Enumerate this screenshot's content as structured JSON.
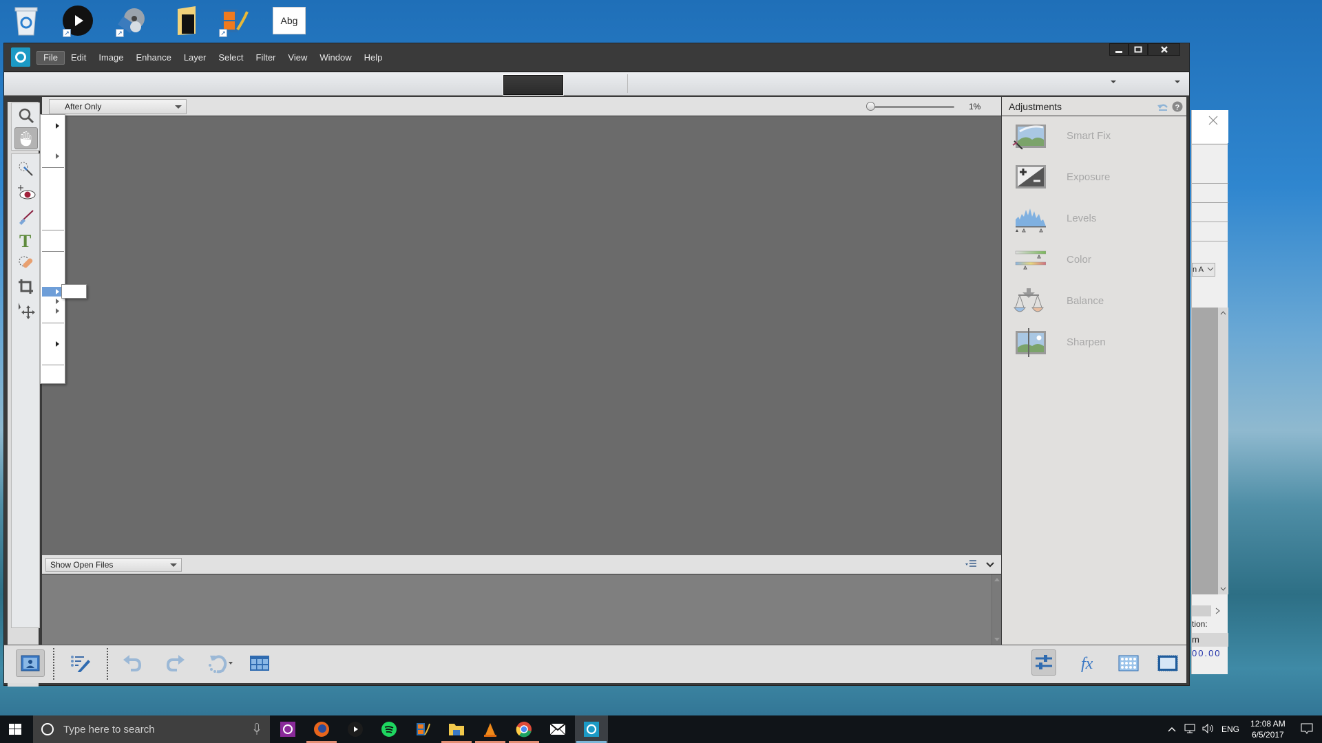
{
  "desktop": {
    "icons": [
      {
        "name": "recycle-bin-icon",
        "label": "Recycle Bin",
        "shortcut": false
      },
      {
        "name": "video-player-icon",
        "label": "",
        "shortcut": true
      },
      {
        "name": "media-player-icon",
        "label": "",
        "shortcut": true
      },
      {
        "name": "folder-icon",
        "label": "",
        "shortcut": false
      },
      {
        "name": "movie-maker-icon",
        "label": "",
        "shortcut": true
      },
      {
        "name": "font-file-icon",
        "label": "Abg",
        "shortcut": false
      }
    ]
  },
  "app": {
    "menu": [
      "File",
      "Edit",
      "Image",
      "Enhance",
      "Layer",
      "Select",
      "Filter",
      "View",
      "Window",
      "Help"
    ],
    "active_menu": "File",
    "window_controls": {
      "minimize": "▁",
      "maximize": "□",
      "close": "✕"
    },
    "options_bar": {
      "view_select": "After Only",
      "zoom_value": "1%",
      "zoom_fraction": 0.01
    },
    "photo_bin": {
      "select_value": "Show Open Files"
    },
    "adjustments": {
      "title": "Adjustments",
      "items": [
        {
          "label": "Smart Fix",
          "icon": "smart-fix-icon"
        },
        {
          "label": "Exposure",
          "icon": "exposure-icon"
        },
        {
          "label": "Levels",
          "icon": "levels-icon"
        },
        {
          "label": "Color",
          "icon": "color-icon"
        },
        {
          "label": "Balance",
          "icon": "balance-icon"
        },
        {
          "label": "Sharpen",
          "icon": "sharpen-icon"
        }
      ]
    },
    "toolbox": [
      "zoom-tool",
      "hand-tool",
      "quick-selection-tool",
      "red-eye-tool",
      "whiten-teeth-tool",
      "type-tool",
      "spot-healing-tool",
      "crop-tool",
      "move-tool"
    ],
    "bottom_bar": {
      "left": [
        "photo-bin",
        "tool-options",
        "undo",
        "redo",
        "rotate",
        "organizer"
      ],
      "right": [
        "adjustments",
        "effects",
        "textures",
        "frames"
      ]
    }
  },
  "background_window": {
    "dropdown_fragment": "n A",
    "label_fragment": "tion:",
    "value_prefix": "m",
    "value_fragment": "00.00"
  },
  "taskbar": {
    "search_placeholder": "Type here to search",
    "apps": [
      "premiere-elements",
      "firefox",
      "video-app",
      "spotify",
      "movie-maker",
      "file-explorer",
      "vlc",
      "chrome",
      "mail",
      "photoshop-elements"
    ],
    "language": "ENG",
    "time": "12:08 AM",
    "date": "6/5/2017"
  }
}
